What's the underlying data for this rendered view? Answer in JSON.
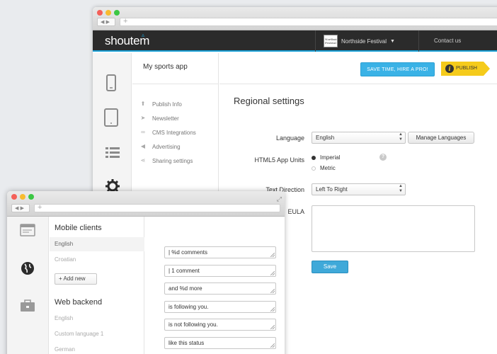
{
  "back_window": {
    "brand": "shoutem",
    "festival": {
      "thumb_text": "Northside Festival",
      "name": "Northside Festival"
    },
    "contact": "Contact us",
    "app_name": "My sports app",
    "subnav": [
      "Publish Info",
      "Newsletter",
      "CMS Integrations",
      "Advertising",
      "Sharing settings"
    ],
    "hire_button": "SAVE TIME, HIRE A PRO!",
    "publish_button": "PUBLISH",
    "section_title": "Regional settings",
    "language_label": "Language",
    "language_value": "English",
    "manage_languages": "Manage Languages",
    "units_label": "HTML5 App Units",
    "units_options": [
      "Imperial",
      "Metric"
    ],
    "units_selected": "Imperial",
    "direction_label": "Text Direction",
    "direction_value": "Left To Right",
    "eula_label": "EULA",
    "save_button": "Save"
  },
  "front_window": {
    "mobile_heading": "Mobile clients",
    "mobile_languages": [
      "English",
      "Croatian"
    ],
    "add_new": "Add new",
    "web_heading": "Web backend",
    "web_languages": [
      "English",
      "Custom language 1",
      "German"
    ],
    "strings": [
      "| %d comments",
      "| 1 comment",
      "and %d more",
      "is following you.",
      "is not following you.",
      "like this status"
    ]
  },
  "colors": {
    "accent_blue": "#1aa0d6",
    "publish_yellow": "#f5cb1b",
    "hire_blue": "#3ab2e6",
    "save_blue": "#3fa9d9"
  }
}
